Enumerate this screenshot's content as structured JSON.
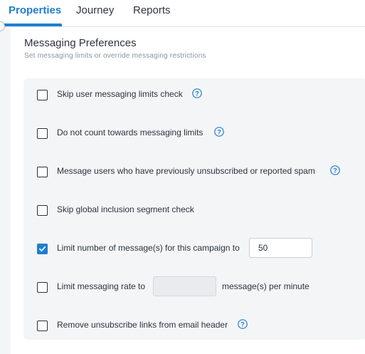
{
  "tabs": [
    {
      "label": "Properties",
      "active": true
    },
    {
      "label": "Journey",
      "active": false
    },
    {
      "label": "Reports",
      "active": false
    }
  ],
  "section": {
    "title": "Messaging Preferences",
    "subtitle": "Set messaging limits or override messaging restrictions"
  },
  "options": [
    {
      "label": "Skip user messaging limits check",
      "checked": false,
      "help": true
    },
    {
      "label": "Do not count towards messaging limits",
      "checked": false,
      "help": true
    },
    {
      "label": "Message users who have previously unsubscribed or reported spam",
      "checked": false,
      "help": true
    },
    {
      "label": "Skip global inclusion segment check",
      "checked": false,
      "help": false
    },
    {
      "label": "Limit number of message(s) for this campaign to",
      "checked": true,
      "help": false,
      "input_value": "50"
    },
    {
      "label": "Limit messaging rate to",
      "checked": false,
      "help": false,
      "input_value": "",
      "suffix": "message(s) per minute"
    },
    {
      "label": "Remove unsubscribe links from email header",
      "checked": false,
      "help": true
    }
  ],
  "colors": {
    "accent": "#1f7ed0",
    "text": "#2b3340",
    "muted": "#8a94a2",
    "card_bg": "#f4f5f7"
  }
}
